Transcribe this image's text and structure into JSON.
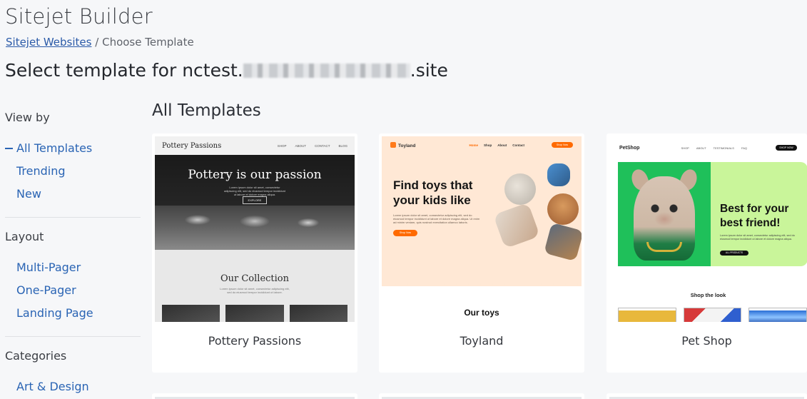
{
  "header": {
    "app_title": "Sitejet Builder",
    "breadcrumb_link": "Sitejet Websites",
    "breadcrumb_sep": "/",
    "breadcrumb_current": "Choose Template",
    "page_title_prefix": "Select template for nctest.",
    "page_title_suffix": ".site"
  },
  "sidebar": {
    "view_by": {
      "heading": "View by",
      "items": [
        {
          "label": "All Templates",
          "active": true
        },
        {
          "label": "Trending"
        },
        {
          "label": "New"
        }
      ]
    },
    "layout": {
      "heading": "Layout",
      "items": [
        {
          "label": "Multi-Pager"
        },
        {
          "label": "One-Pager"
        },
        {
          "label": "Landing Page"
        }
      ]
    },
    "categories": {
      "heading": "Categories",
      "items": [
        {
          "label": "Art & Design"
        }
      ]
    }
  },
  "main": {
    "section_title": "All Templates",
    "templates": [
      {
        "name": "Pottery Passions",
        "preview": {
          "brand": "Pottery Passions",
          "menu": [
            "SHOP",
            "ABOUT",
            "CONTACT",
            "BLOG"
          ],
          "hero_title": "Pottery is our passion",
          "hero_text": "Lorem ipsum dolor sit amet, consectetur adipiscing elit, sed do eiusmod tempor incididunt ut labore et dolore magna aliqua.",
          "hero_button": "EXPLORE",
          "collection_title": "Our Collection",
          "collection_text": "Lorem ipsum dolor sit amet, consectetur adipiscing elit, sed do eiusmod tempor incididunt ut labore."
        }
      },
      {
        "name": "Toyland",
        "preview": {
          "brand": "Toyland",
          "menu": [
            "Home",
            "Shop",
            "About",
            "Contact"
          ],
          "shop_button": "Shop Now",
          "hero_title_1": "Find toys that",
          "hero_title_2": "your kids like",
          "hero_text": "Lorem ipsum dolor sit amet, consectetur adipiscing elit, sed do eiusmod tempor incididunt ut labore et dolore magna aliqua. Ut enim ad minim veniam, quis nostrud exercitation ullamco laboris.",
          "hero_button": "Shop Now",
          "section_title": "Our toys"
        }
      },
      {
        "name": "Pet Shop",
        "preview": {
          "brand": "PetShop",
          "menu": [
            "SHOP",
            "ABOUT",
            "TESTIMONIALS",
            "FAQ"
          ],
          "shop_button": "SHOP NOW",
          "hero_title_1": "Best for your",
          "hero_title_2": "best friend!",
          "hero_text": "Lorem ipsum dolor sit amet, consectetur adipiscing elit, sed do eiusmod tempor incididunt ut labore et dolore magna aliqua.",
          "hero_button": "ALL PRODUCTS",
          "section_title": "Shop the look"
        }
      }
    ]
  }
}
